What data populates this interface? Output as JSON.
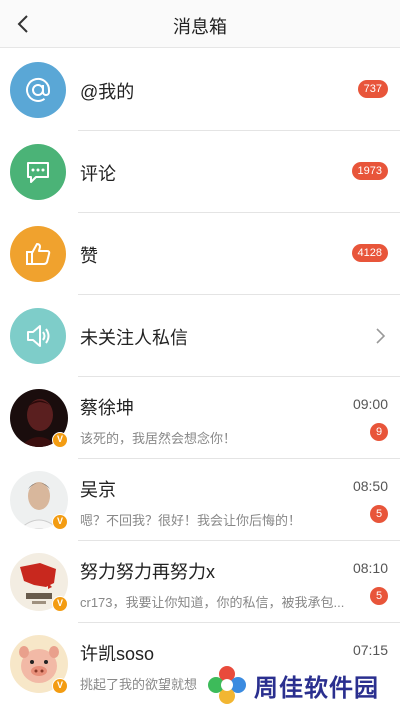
{
  "header": {
    "title": "消息箱"
  },
  "categories": [
    {
      "label": "@我的",
      "count": "737",
      "icon": "at-icon",
      "color": "#5aa7d6"
    },
    {
      "label": "评论",
      "count": "1973",
      "icon": "comment-icon",
      "color": "#4bb377"
    },
    {
      "label": "赞",
      "count": "4128",
      "icon": "thumbs-up-icon",
      "color": "#f0a22e"
    },
    {
      "label": "未关注人私信",
      "icon": "speaker-icon",
      "color": "#7ecdc9"
    }
  ],
  "messages": [
    {
      "name": "蔡徐坤",
      "time": "09:00",
      "preview": "该死的，我居然会想念你！",
      "unread": "9"
    },
    {
      "name": "吴京",
      "time": "08:50",
      "preview": "嗯？不回我？很好！我会让你后悔的！",
      "unread": "5"
    },
    {
      "name": "努力努力再努力x",
      "time": "08:10",
      "preview": "cr173，我要让你知道，你的私信，被我承包...",
      "unread": "5"
    },
    {
      "name": "许凯soso",
      "time": "07:15",
      "preview": "挑起了我的欲望就想"
    }
  ],
  "avatar_badge": "V",
  "watermark": {
    "text": "周佳软件园"
  },
  "colors": {
    "badge": "#e8553a",
    "verified": "#f39c12"
  }
}
